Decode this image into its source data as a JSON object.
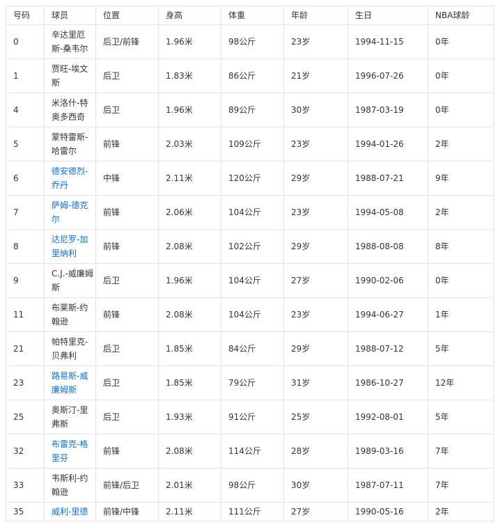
{
  "headers": [
    "号码",
    "球员",
    "位置",
    "身高",
    "体重",
    "年龄",
    "生日",
    "NBA球龄"
  ],
  "rows": [
    {
      "number": "0",
      "player": "辛达里厄斯-桑韦尔",
      "link": false,
      "position": "后卫/前锋",
      "height": "1.96米",
      "weight": "98公斤",
      "age": "23岁",
      "birthday": "1994-11-15",
      "nba_years": "0年"
    },
    {
      "number": "1",
      "player": "贾旺-埃文斯",
      "link": false,
      "position": "后卫",
      "height": "1.83米",
      "weight": "86公斤",
      "age": "21岁",
      "birthday": "1996-07-26",
      "nba_years": "0年"
    },
    {
      "number": "4",
      "player": "米洛什-特奥多西奇",
      "link": false,
      "position": "后卫",
      "height": "1.96米",
      "weight": "89公斤",
      "age": "30岁",
      "birthday": "1987-03-19",
      "nba_years": "0年"
    },
    {
      "number": "5",
      "player": "蒙特雷斯-哈雷尔",
      "link": false,
      "position": "前锋",
      "height": "2.03米",
      "weight": "109公斤",
      "age": "23岁",
      "birthday": "1994-01-26",
      "nba_years": "2年"
    },
    {
      "number": "6",
      "player": "德安德烈-乔丹",
      "link": true,
      "position": "中锋",
      "height": "2.11米",
      "weight": "120公斤",
      "age": "29岁",
      "birthday": "1988-07-21",
      "nba_years": "9年"
    },
    {
      "number": "7",
      "player": "萨姆-德克尔",
      "link": true,
      "position": "前锋",
      "height": "2.06米",
      "weight": "104公斤",
      "age": "23岁",
      "birthday": "1994-05-08",
      "nba_years": "2年"
    },
    {
      "number": "8",
      "player": "达尼罗-加里纳利",
      "link": true,
      "position": "前锋",
      "height": "2.08米",
      "weight": "102公斤",
      "age": "29岁",
      "birthday": "1988-08-08",
      "nba_years": "8年"
    },
    {
      "number": "9",
      "player": "C.J.-威廉姆斯",
      "link": false,
      "position": "后卫",
      "height": "1.96米",
      "weight": "104公斤",
      "age": "27岁",
      "birthday": "1990-02-06",
      "nba_years": "0年"
    },
    {
      "number": "11",
      "player": "布莱斯-约翰逊",
      "link": false,
      "position": "前锋",
      "height": "2.08米",
      "weight": "104公斤",
      "age": "23岁",
      "birthday": "1994-06-27",
      "nba_years": "1年"
    },
    {
      "number": "21",
      "player": "帕特里克-贝弗利",
      "link": false,
      "position": "后卫",
      "height": "1.85米",
      "weight": "84公斤",
      "age": "29岁",
      "birthday": "1988-07-12",
      "nba_years": "5年"
    },
    {
      "number": "23",
      "player": "路易斯-威廉姆斯",
      "link": true,
      "position": "后卫",
      "height": "1.85米",
      "weight": "79公斤",
      "age": "31岁",
      "birthday": "1986-10-27",
      "nba_years": "12年"
    },
    {
      "number": "25",
      "player": "奥斯汀-里弗斯",
      "link": false,
      "position": "后卫",
      "height": "1.93米",
      "weight": "91公斤",
      "age": "25岁",
      "birthday": "1992-08-01",
      "nba_years": "5年"
    },
    {
      "number": "32",
      "player": "布雷克-格里芬",
      "link": true,
      "position": "前锋",
      "height": "2.08米",
      "weight": "114公斤",
      "age": "28岁",
      "birthday": "1989-03-16",
      "nba_years": "7年"
    },
    {
      "number": "33",
      "player": "韦斯利-约翰逊",
      "link": false,
      "position": "前锋/后卫",
      "height": "2.01米",
      "weight": "98公斤",
      "age": "30岁",
      "birthday": "1987-07-11",
      "nba_years": "7年"
    },
    {
      "number": "35",
      "player": "威利-里德",
      "link": true,
      "position": "前锋/中锋",
      "height": "2.11米",
      "weight": "111公斤",
      "age": "27岁",
      "birthday": "1990-05-16",
      "nba_years": "2年"
    }
  ],
  "colors": {
    "link": "#136ec2",
    "text": "#333333",
    "border": "#e3e3e3"
  }
}
